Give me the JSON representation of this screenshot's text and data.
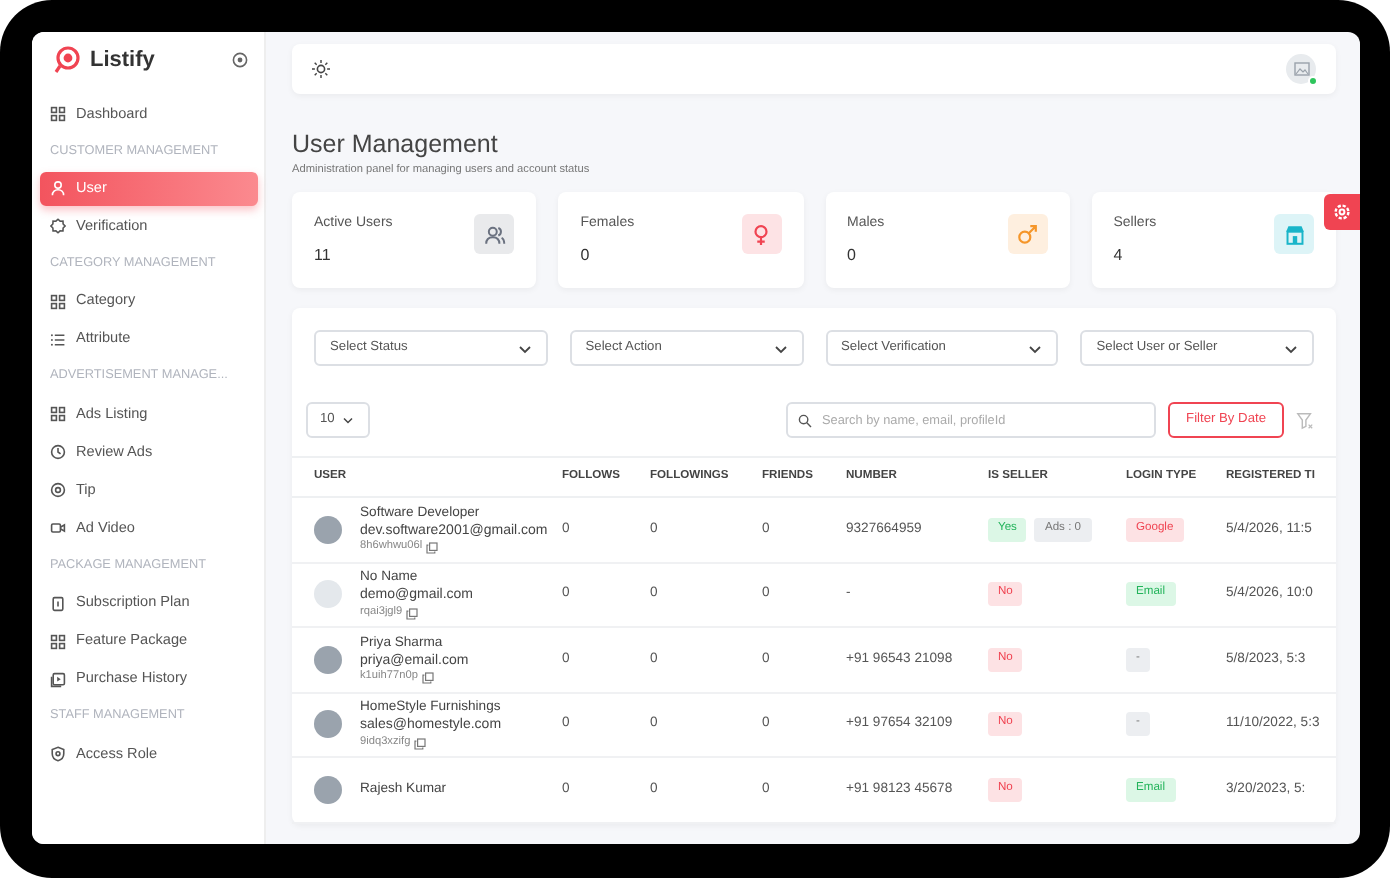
{
  "brand": {
    "name": "Listify"
  },
  "sidebar": {
    "items": [
      {
        "kind": "link",
        "label": "Dashboard",
        "selected": false
      },
      {
        "kind": "section",
        "label": "CUSTOMER MANAGEMENT"
      },
      {
        "kind": "link",
        "label": "User",
        "selected": true
      },
      {
        "kind": "link",
        "label": "Verification",
        "selected": false
      },
      {
        "kind": "section",
        "label": "CATEGORY MANAGEMENT"
      },
      {
        "kind": "link",
        "label": "Category",
        "selected": false
      },
      {
        "kind": "link",
        "label": "Attribute",
        "selected": false
      },
      {
        "kind": "section",
        "label": "ADVERTISEMENT MANAGE..."
      },
      {
        "kind": "link",
        "label": "Ads Listing",
        "selected": false
      },
      {
        "kind": "link",
        "label": "Review Ads",
        "selected": false
      },
      {
        "kind": "link",
        "label": "Tip",
        "selected": false
      },
      {
        "kind": "link",
        "label": "Ad Video",
        "selected": false
      },
      {
        "kind": "section",
        "label": "PACKAGE MANAGEMENT"
      },
      {
        "kind": "link",
        "label": "Subscription Plan",
        "selected": false
      },
      {
        "kind": "link",
        "label": "Feature Package",
        "selected": false
      },
      {
        "kind": "link",
        "label": "Purchase History",
        "selected": false
      },
      {
        "kind": "section",
        "label": "STAFF MANAGEMENT"
      },
      {
        "kind": "link",
        "label": "Access Role",
        "selected": false
      }
    ]
  },
  "header": {
    "title": "User Management",
    "subtitle": "Administration panel for managing users and account status"
  },
  "stats": [
    {
      "label": "Active Users",
      "value": "11",
      "color": "#6b7280"
    },
    {
      "label": "Females",
      "value": "0",
      "color": "#f04452"
    },
    {
      "label": "Males",
      "value": "0",
      "color": "#f5962a"
    },
    {
      "label": "Sellers",
      "value": "4",
      "color": "#19b5c9"
    }
  ],
  "filters": [
    {
      "placeholder": "Select Status"
    },
    {
      "placeholder": "Select Action"
    },
    {
      "placeholder": "Select Verification"
    },
    {
      "placeholder": "Select User or Seller"
    }
  ],
  "page_size": "10",
  "search": {
    "placeholder": "Search by name, email, profileId"
  },
  "filter_button": "Filter By Date",
  "table": {
    "columns": [
      "USER",
      "FOLLOWS",
      "FOLLOWINGS",
      "FRIENDS",
      "NUMBER",
      "IS SELLER",
      "LOGIN TYPE",
      "REGISTERED TI"
    ],
    "rows": [
      {
        "avatar": {
          "kind": "photo"
        },
        "name": "Software Developer",
        "email": "dev.software2001@gmail.com",
        "profile_id": "8h6whwu06l",
        "follows": "0",
        "followings": "0",
        "friends": "0",
        "number": "9327664959",
        "is_seller": {
          "label": "Yes",
          "kind": "yes"
        },
        "ads": "Ads : 0",
        "login_type": {
          "label": "Google",
          "kind": "google"
        },
        "registered": "5/4/2026, 11:5"
      },
      {
        "avatar": {
          "kind": "placeholder"
        },
        "name": "No Name",
        "email": "demo@gmail.com",
        "profile_id": "rqai3jgl9",
        "follows": "0",
        "followings": "0",
        "friends": "0",
        "number": "-",
        "is_seller": {
          "label": "No",
          "kind": "no"
        },
        "login_type": {
          "label": "Email",
          "kind": "email"
        },
        "registered": "5/4/2026, 10:0"
      },
      {
        "avatar": {
          "kind": "photo"
        },
        "name": "Priya Sharma",
        "email": "priya@email.com",
        "profile_id": "k1uih77n0p",
        "follows": "0",
        "followings": "0",
        "friends": "0",
        "number": "+91 96543 21098",
        "is_seller": {
          "label": "No",
          "kind": "no"
        },
        "login_type": {
          "label": "-",
          "kind": "none"
        },
        "registered": "5/8/2023, 5:3"
      },
      {
        "avatar": {
          "kind": "photo"
        },
        "name": "HomeStyle Furnishings",
        "email": "sales@homestyle.com",
        "profile_id": "9idq3xzifg",
        "follows": "0",
        "followings": "0",
        "friends": "0",
        "number": "+91 97654 32109",
        "is_seller": {
          "label": "No",
          "kind": "no"
        },
        "login_type": {
          "label": "-",
          "kind": "none"
        },
        "registered": "11/10/2022, 5:3"
      },
      {
        "avatar": {
          "kind": "photo"
        },
        "name": "Rajesh Kumar",
        "follows": "0",
        "followings": "0",
        "friends": "0",
        "number": "+91 98123 45678",
        "is_seller": {
          "label": "No",
          "kind": "no"
        },
        "login_type": {
          "label": "Email",
          "kind": "email"
        },
        "registered": "3/20/2023, 5:"
      }
    ]
  }
}
